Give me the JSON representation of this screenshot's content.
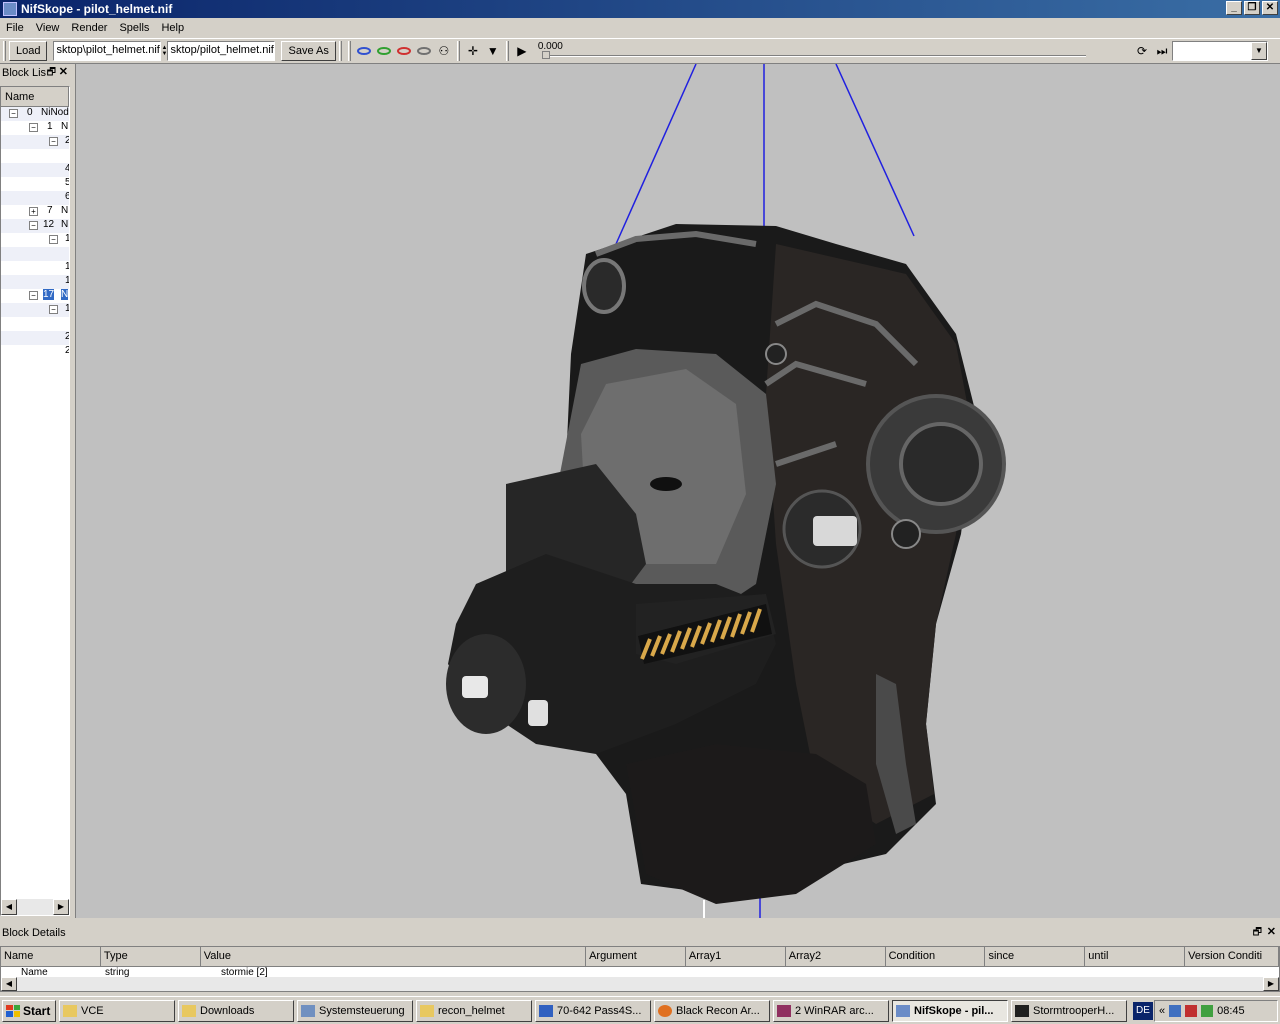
{
  "window": {
    "title": "NifSkope - pilot_helmet.nif"
  },
  "menu": [
    "File",
    "View",
    "Render",
    "Spells",
    "Help"
  ],
  "toolbar": {
    "load_label": "Load",
    "load_path": "sktop\\pilot_helmet.nif",
    "save_path": "sktop/pilot_helmet.nif",
    "save_label": "Save As",
    "time_value": "0.000",
    "icons": [
      "view-blue-eye-icon",
      "view-green-eye-icon",
      "view-red-eye-icon",
      "view-grey-eye-icon",
      "walk-icon",
      "axes-icon",
      "dropdown-arrow-icon",
      "play-icon",
      "loop-icon",
      "switch-icon"
    ]
  },
  "blocklist": {
    "title": "Block Lis",
    "column": "Name",
    "rows": [
      {
        "num": "0",
        "text": "NiNod"
      },
      {
        "num": "1",
        "text": "N"
      },
      {
        "num": "",
        "text": "2"
      },
      {
        "num": "",
        "text": ""
      },
      {
        "num": "",
        "text": "4"
      },
      {
        "num": "",
        "text": "5"
      },
      {
        "num": "",
        "text": "6"
      },
      {
        "num": "7",
        "text": "N"
      },
      {
        "num": "12",
        "text": "N"
      },
      {
        "num": "",
        "text": "1"
      },
      {
        "num": "",
        "text": ""
      },
      {
        "num": "",
        "text": "1"
      },
      {
        "num": "",
        "text": "1"
      },
      {
        "num": "17",
        "text": "N"
      },
      {
        "num": "",
        "text": "1"
      },
      {
        "num": "",
        "text": ""
      },
      {
        "num": "",
        "text": "2"
      },
      {
        "num": "",
        "text": "2"
      }
    ]
  },
  "details": {
    "title": "Block Details",
    "columns": [
      "Name",
      "Type",
      "Value",
      "Argument",
      "Array1",
      "Array2",
      "Condition",
      "since",
      "until",
      "Version Conditi"
    ],
    "row": {
      "name": "Name",
      "type": "string",
      "value": "stormie [2]"
    }
  },
  "taskbar": {
    "start": "Start",
    "tasks": [
      "VCE",
      "Downloads",
      "Systemsteuerung",
      "recon_helmet",
      "70-642 Pass4S...",
      "Black Recon Ar...",
      "2 WinRAR arc...",
      "NifSkope - pil...",
      "StormtrooperH..."
    ],
    "lang": "DE",
    "clock": "08:45"
  },
  "colors": {
    "titlebar": "#0a246a",
    "selection": "#316ac5",
    "viewport_bg": "#c0c0c0"
  }
}
